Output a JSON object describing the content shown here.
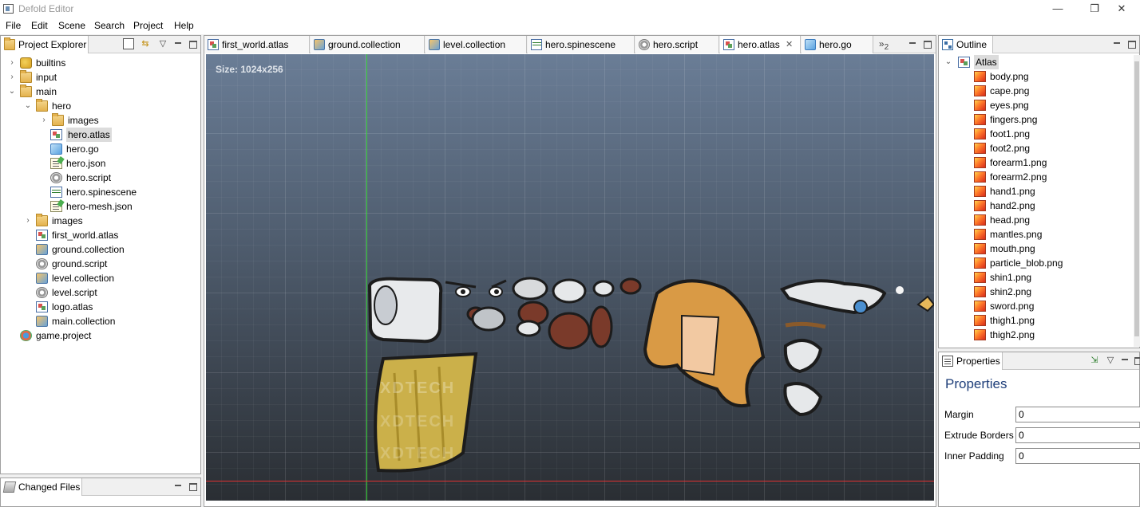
{
  "window": {
    "title": "Defold Editor",
    "controls": {
      "minimize": "—",
      "restore": "❐",
      "close": "✕"
    }
  },
  "menu": [
    "File",
    "Edit",
    "Scene",
    "Search",
    "Project",
    "Help"
  ],
  "project_explorer": {
    "tab_label": "Project Explorer",
    "items": [
      {
        "label": "builtins",
        "icon": "builtins-icon",
        "chevron": "›"
      },
      {
        "label": "input",
        "icon": "folder-icon",
        "chevron": "›"
      },
      {
        "label": "main",
        "icon": "folder-icon",
        "chevron": "⌄"
      },
      {
        "label": "hero",
        "icon": "folder-icon",
        "chevron": "⌄"
      },
      {
        "label": "images",
        "icon": "folder-icon",
        "chevron": "›"
      },
      {
        "label": "hero.atlas",
        "icon": "atlas-icon"
      },
      {
        "label": "hero.go",
        "icon": "go-icon"
      },
      {
        "label": "hero.json",
        "icon": "json-icon"
      },
      {
        "label": "hero.script",
        "icon": "script-icon"
      },
      {
        "label": "hero.spinescene",
        "icon": "spine-icon"
      },
      {
        "label": "hero-mesh.json",
        "icon": "json-icon"
      },
      {
        "label": "images",
        "icon": "folder-icon",
        "chevron": "›"
      },
      {
        "label": "first_world.atlas",
        "icon": "atlas-icon"
      },
      {
        "label": "ground.collection",
        "icon": "collection-icon"
      },
      {
        "label": "ground.script",
        "icon": "script-icon"
      },
      {
        "label": "level.collection",
        "icon": "collection-icon"
      },
      {
        "label": "level.script",
        "icon": "script-icon"
      },
      {
        "label": "logo.atlas",
        "icon": "atlas-icon"
      },
      {
        "label": "main.collection",
        "icon": "collection-icon"
      },
      {
        "label": "game.project",
        "icon": "project-icon"
      }
    ]
  },
  "changed_files": {
    "tab_label": "Changed Files"
  },
  "editor_tabs": [
    {
      "label": "first_world.atlas",
      "icon": "atlas-icon"
    },
    {
      "label": "ground.collection",
      "icon": "collection-icon"
    },
    {
      "label": "level.collection",
      "icon": "collection-icon"
    },
    {
      "label": "hero.spinescene",
      "icon": "spine-icon"
    },
    {
      "label": "hero.script",
      "icon": "script-icon"
    },
    {
      "label": "hero.atlas",
      "icon": "atlas-icon",
      "active": true
    },
    {
      "label": "hero.go",
      "icon": "go-icon"
    }
  ],
  "overflow_tabs": {
    "glyph": "»",
    "count": "2"
  },
  "close_tab_glyph": "✕",
  "canvas": {
    "size_label": "Size: 1024x256",
    "watermark": "XDTECH"
  },
  "outline": {
    "tab_label": "Outline",
    "root": "Atlas",
    "items": [
      "body.png",
      "cape.png",
      "eyes.png",
      "fingers.png",
      "foot1.png",
      "foot2.png",
      "forearm1.png",
      "forearm2.png",
      "hand1.png",
      "hand2.png",
      "head.png",
      "mantles.png",
      "mouth.png",
      "particle_blob.png",
      "shin1.png",
      "shin2.png",
      "sword.png",
      "thigh1.png",
      "thigh2.png"
    ]
  },
  "properties": {
    "tab_label": "Properties",
    "heading": "Properties",
    "fields": [
      {
        "label": "Margin",
        "value": "0"
      },
      {
        "label": "Extrude Borders",
        "value": "0"
      },
      {
        "label": "Inner Padding",
        "value": "0"
      }
    ]
  }
}
